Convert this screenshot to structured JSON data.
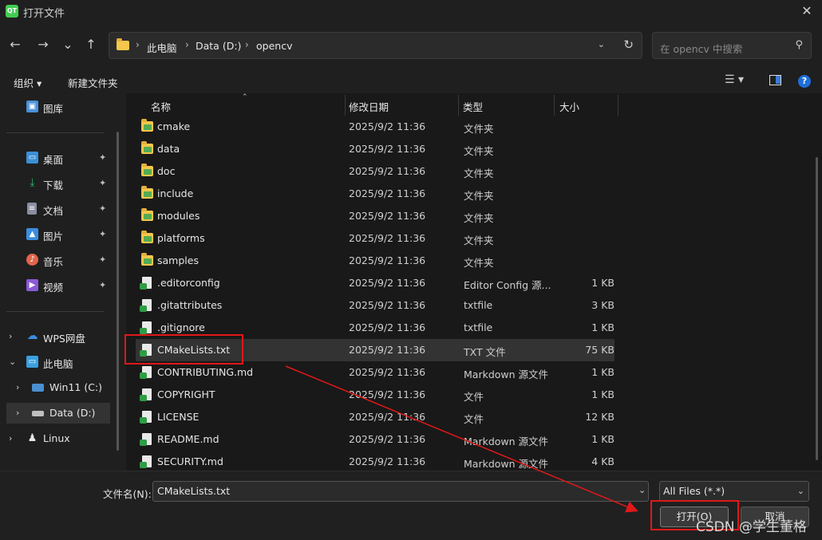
{
  "window": {
    "app_icon_text": "QT",
    "title": "打开文件",
    "close_glyph": "✕"
  },
  "nav": {
    "back": "←",
    "forward": "→",
    "history": "⌄",
    "up": "↑",
    "breadcrumbs": [
      "此电脑",
      "Data (D:)",
      "opencv"
    ],
    "sep": "›",
    "dropdown": "⌄",
    "refresh": "↻",
    "search_placeholder": "在 opencv 中搜索",
    "search_glyph": "⚲"
  },
  "toolbar": {
    "organize": "组织 ▾",
    "new_folder": "新建文件夹",
    "view_glyph": "☰ ▾",
    "help": "?"
  },
  "sidebar": {
    "items": [
      {
        "label": "图库",
        "icon": "gallery-icon",
        "color": "#4a90d9"
      },
      {
        "label": "桌面",
        "icon": "desktop-icon",
        "color": "#3b8fd6",
        "pinned": true
      },
      {
        "label": "下载",
        "icon": "download-icon",
        "color": "#2fb36e",
        "pinned": true
      },
      {
        "label": "文档",
        "icon": "document-icon",
        "color": "#8a8fa0",
        "pinned": true
      },
      {
        "label": "图片",
        "icon": "pictures-icon",
        "color": "#3a8de0",
        "pinned": true
      },
      {
        "label": "音乐",
        "icon": "music-icon",
        "color": "#e0664a",
        "pinned": true
      },
      {
        "label": "视频",
        "icon": "video-icon",
        "color": "#8a5ad6",
        "pinned": true
      },
      {
        "label": "WPS网盘",
        "icon": "cloud-icon",
        "color": "#3a8de0"
      },
      {
        "label": "此电脑",
        "icon": "computer-icon",
        "color": "#3aa0e0"
      },
      {
        "label": "Win11 (C:)",
        "icon": "drive-c-icon",
        "color": "#4a8fd0"
      },
      {
        "label": "Data (D:)",
        "icon": "drive-d-icon",
        "color": "#c0c0c0"
      },
      {
        "label": "Linux",
        "icon": "linux-icon",
        "color": "#e8e8e8"
      }
    ],
    "pin_glyph": "📌"
  },
  "columns": {
    "name": "名称",
    "date": "修改日期",
    "type": "类型",
    "size": "大小",
    "sort_glyph": "⌃"
  },
  "files": [
    {
      "name": "cmake",
      "date": "2025/9/2 11:36",
      "type": "文件夹",
      "size": "",
      "kind": "folder"
    },
    {
      "name": "data",
      "date": "2025/9/2 11:36",
      "type": "文件夹",
      "size": "",
      "kind": "folder"
    },
    {
      "name": "doc",
      "date": "2025/9/2 11:36",
      "type": "文件夹",
      "size": "",
      "kind": "folder"
    },
    {
      "name": "include",
      "date": "2025/9/2 11:36",
      "type": "文件夹",
      "size": "",
      "kind": "folder"
    },
    {
      "name": "modules",
      "date": "2025/9/2 11:36",
      "type": "文件夹",
      "size": "",
      "kind": "folder"
    },
    {
      "name": "platforms",
      "date": "2025/9/2 11:36",
      "type": "文件夹",
      "size": "",
      "kind": "folder"
    },
    {
      "name": "samples",
      "date": "2025/9/2 11:36",
      "type": "文件夹",
      "size": "",
      "kind": "folder"
    },
    {
      "name": ".editorconfig",
      "date": "2025/9/2 11:36",
      "type": "Editor Config 源...",
      "size": "1 KB",
      "kind": "file"
    },
    {
      "name": ".gitattributes",
      "date": "2025/9/2 11:36",
      "type": "txtfile",
      "size": "3 KB",
      "kind": "file"
    },
    {
      "name": ".gitignore",
      "date": "2025/9/2 11:36",
      "type": "txtfile",
      "size": "1 KB",
      "kind": "file"
    },
    {
      "name": "CMakeLists.txt",
      "date": "2025/9/2 11:36",
      "type": "TXT 文件",
      "size": "75 KB",
      "kind": "file",
      "selected": true
    },
    {
      "name": "CONTRIBUTING.md",
      "date": "2025/9/2 11:36",
      "type": "Markdown 源文件",
      "size": "1 KB",
      "kind": "file"
    },
    {
      "name": "COPYRIGHT",
      "date": "2025/9/2 11:36",
      "type": "文件",
      "size": "1 KB",
      "kind": "file"
    },
    {
      "name": "LICENSE",
      "date": "2025/9/2 11:36",
      "type": "文件",
      "size": "12 KB",
      "kind": "file"
    },
    {
      "name": "README.md",
      "date": "2025/9/2 11:36",
      "type": "Markdown 源文件",
      "size": "1 KB",
      "kind": "file"
    },
    {
      "name": "SECURITY.md",
      "date": "2025/9/2 11:36",
      "type": "Markdown 源文件",
      "size": "4 KB",
      "kind": "file"
    }
  ],
  "footer": {
    "filename_label": "文件名(N):",
    "filename_value": "CMakeLists.txt",
    "filter_value": "All Files (*.*)",
    "open_label": "打开(O)",
    "cancel_label": "取消",
    "dropdown": "⌄"
  },
  "watermark": "CSDN @学生董格",
  "colors": {
    "annotation": "#e01818",
    "folder": "#f5c74a",
    "accent": "#1e6fd9"
  }
}
